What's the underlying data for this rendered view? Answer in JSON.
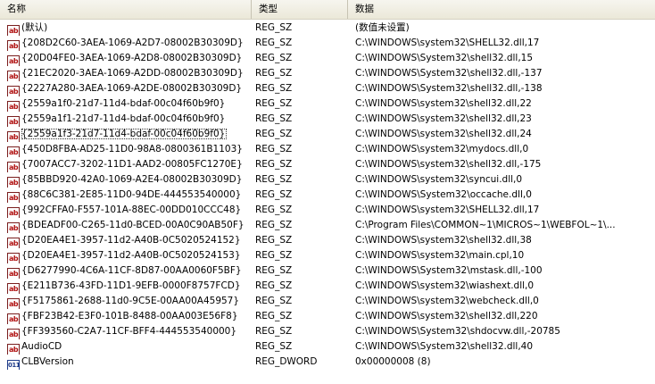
{
  "columns": {
    "name": "名称",
    "type": "类型",
    "data": "数据"
  },
  "rows": [
    {
      "icon": "string-value-icon",
      "name": "(默认)",
      "type": "REG_SZ",
      "data": "(数值未设置)"
    },
    {
      "icon": "string-value-icon",
      "name": "{208D2C60-3AEA-1069-A2D7-08002B30309D}",
      "type": "REG_SZ",
      "data": "C:\\WINDOWS\\system32\\SHELL32.dll,17"
    },
    {
      "icon": "string-value-icon",
      "name": "{20D04FE0-3AEA-1069-A2D8-08002B30309D}",
      "type": "REG_SZ",
      "data": "C:\\WINDOWS\\System32\\shell32.dll,15"
    },
    {
      "icon": "string-value-icon",
      "name": "{21EC2020-3AEA-1069-A2DD-08002B30309D}",
      "type": "REG_SZ",
      "data": "C:\\WINDOWS\\System32\\shell32.dll,-137"
    },
    {
      "icon": "string-value-icon",
      "name": "{2227A280-3AEA-1069-A2DE-08002B30309D}",
      "type": "REG_SZ",
      "data": "C:\\WINDOWS\\System32\\shell32.dll,-138"
    },
    {
      "icon": "string-value-icon",
      "name": "{2559a1f0-21d7-11d4-bdaf-00c04f60b9f0}",
      "type": "REG_SZ",
      "data": "C:\\WINDOWS\\system32\\shell32.dll,22"
    },
    {
      "icon": "string-value-icon",
      "name": "{2559a1f1-21d7-11d4-bdaf-00c04f60b9f0}",
      "type": "REG_SZ",
      "data": "C:\\WINDOWS\\system32\\shell32.dll,23"
    },
    {
      "icon": "string-value-icon",
      "name": "{2559a1f3-21d7-11d4-bdaf-00c04f60b9f0}",
      "type": "REG_SZ",
      "data": "C:\\WINDOWS\\system32\\shell32.dll,24",
      "focused": true
    },
    {
      "icon": "string-value-icon",
      "name": "{450D8FBA-AD25-11D0-98A8-0800361B1103}",
      "type": "REG_SZ",
      "data": "C:\\WINDOWS\\system32\\mydocs.dll,0"
    },
    {
      "icon": "string-value-icon",
      "name": "{7007ACC7-3202-11D1-AAD2-00805FC1270E}",
      "type": "REG_SZ",
      "data": "C:\\WINDOWS\\system32\\shell32.dll,-175"
    },
    {
      "icon": "string-value-icon",
      "name": "{85BBD920-42A0-1069-A2E4-08002B30309D}",
      "type": "REG_SZ",
      "data": "C:\\WINDOWS\\system32\\syncui.dll,0"
    },
    {
      "icon": "string-value-icon",
      "name": "{88C6C381-2E85-11D0-94DE-444553540000}",
      "type": "REG_SZ",
      "data": "C:\\WINDOWS\\System32\\occache.dll,0"
    },
    {
      "icon": "string-value-icon",
      "name": "{992CFFA0-F557-101A-88EC-00DD010CCC48}",
      "type": "REG_SZ",
      "data": "C:\\WINDOWS\\system32\\SHELL32.dll,17"
    },
    {
      "icon": "string-value-icon",
      "name": "{BDEADF00-C265-11d0-BCED-00A0C90AB50F}",
      "type": "REG_SZ",
      "data": "C:\\Program Files\\COMMON~1\\MICROS~1\\WEBFOL~1\\..."
    },
    {
      "icon": "string-value-icon",
      "name": "{D20EA4E1-3957-11d2-A40B-0C5020524152}",
      "type": "REG_SZ",
      "data": "C:\\WINDOWS\\system32\\shell32.dll,38"
    },
    {
      "icon": "string-value-icon",
      "name": "{D20EA4E1-3957-11d2-A40B-0C5020524153}",
      "type": "REG_SZ",
      "data": "C:\\WINDOWS\\system32\\main.cpl,10"
    },
    {
      "icon": "string-value-icon",
      "name": "{D6277990-4C6A-11CF-8D87-00AA0060F5BF}",
      "type": "REG_SZ",
      "data": "C:\\WINDOWS\\System32\\mstask.dll,-100"
    },
    {
      "icon": "string-value-icon",
      "name": "{E211B736-43FD-11D1-9EFB-0000F8757FCD}",
      "type": "REG_SZ",
      "data": "C:\\WINDOWS\\system32\\wiashext.dll,0"
    },
    {
      "icon": "string-value-icon",
      "name": "{F5175861-2688-11d0-9C5E-00AA00A45957}",
      "type": "REG_SZ",
      "data": "C:\\WINDOWS\\system32\\webcheck.dll,0"
    },
    {
      "icon": "string-value-icon",
      "name": "{FBF23B42-E3F0-101B-8488-00AA003E56F8}",
      "type": "REG_SZ",
      "data": "C:\\WINDOWS\\system32\\shell32.dll,220"
    },
    {
      "icon": "string-value-icon",
      "name": "{FF393560-C2A7-11CF-BFF4-444553540000}",
      "type": "REG_SZ",
      "data": "C:\\WINDOWS\\System32\\shdocvw.dll,-20785"
    },
    {
      "icon": "string-value-icon",
      "name": "AudioCD",
      "type": "REG_SZ",
      "data": "C:\\WINDOWS\\System32\\shell32.dll,40"
    },
    {
      "icon": "binary-value-icon",
      "name": "CLBVersion",
      "type": "REG_DWORD",
      "data": "0x00000008 (8)"
    }
  ]
}
